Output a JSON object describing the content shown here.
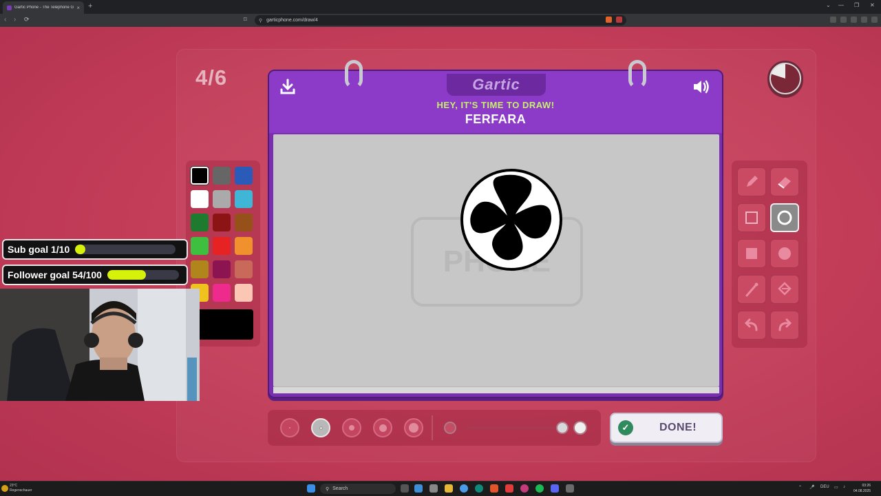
{
  "browser": {
    "tab_title": "Gartic Phone - The Telephone Game",
    "tab_close": "×",
    "new_tab": "+",
    "url": "garticphone.com/draw/4",
    "nav_back": "‹",
    "nav_forward": "›",
    "reload": "⟳",
    "window_minimize": "—",
    "window_restore": "❐",
    "window_close": "✕"
  },
  "game": {
    "round": "4/6",
    "logo": "Gartic",
    "prompt_heading": "HEY, IT'S TIME TO DRAW!",
    "prompt_word": "FERFARA",
    "watermark": "PHONE",
    "done_label": "DONE!",
    "timer_elapsed_fraction": 0.8,
    "colors": {
      "background": "#c23c58",
      "notebook": "#7a2fb0",
      "prompt": "#c8f06a",
      "selected_color": "#000000"
    },
    "palette": [
      {
        "name": "black",
        "color": "#000000",
        "selected": true
      },
      {
        "name": "dark-gray",
        "color": "#666666"
      },
      {
        "name": "blue",
        "color": "#2b5bb8"
      },
      {
        "name": "white",
        "color": "#ffffff"
      },
      {
        "name": "light-gray",
        "color": "#aaaaaa"
      },
      {
        "name": "cyan",
        "color": "#3fb6d6"
      },
      {
        "name": "dark-green",
        "color": "#1e7a2e"
      },
      {
        "name": "dark-red",
        "color": "#8c1414"
      },
      {
        "name": "brown",
        "color": "#96501a"
      },
      {
        "name": "green",
        "color": "#3fbf3f"
      },
      {
        "name": "red",
        "color": "#e62222"
      },
      {
        "name": "orange",
        "color": "#f0912d"
      },
      {
        "name": "dark-yellow",
        "color": "#b0861c"
      },
      {
        "name": "maroon",
        "color": "#8c1450"
      },
      {
        "name": "salmon",
        "color": "#c8695a"
      },
      {
        "name": "yellow",
        "color": "#f0c21e"
      },
      {
        "name": "pink",
        "color": "#ee2a8c"
      },
      {
        "name": "peach",
        "color": "#fcc6b4"
      }
    ],
    "tools": [
      {
        "name": "pencil"
      },
      {
        "name": "eraser"
      },
      {
        "name": "rectangle-outline"
      },
      {
        "name": "ellipse-outline",
        "selected": true
      },
      {
        "name": "rectangle-filled"
      },
      {
        "name": "ellipse-filled"
      },
      {
        "name": "line"
      },
      {
        "name": "fill-bucket"
      },
      {
        "name": "undo"
      },
      {
        "name": "redo"
      }
    ],
    "brush_sizes": [
      {
        "name": "size-1"
      },
      {
        "name": "size-2",
        "selected": true
      },
      {
        "name": "size-3"
      },
      {
        "name": "size-4"
      },
      {
        "name": "size-5"
      }
    ],
    "opacity_fraction": 1.0
  },
  "overlay": {
    "sub_goal": {
      "label": "Sub goal 1/10",
      "progress": 0.1,
      "color": "#d7f20a"
    },
    "follower_goal": {
      "label": "Follower goal 54/100",
      "progress": 0.54,
      "color": "#d7f20a"
    }
  },
  "taskbar": {
    "weather_temp": "23°C",
    "weather_desc": "Regenschauer",
    "search_label": "Search",
    "language": "DEU",
    "time": "03:26",
    "date": "04.08.2025"
  }
}
